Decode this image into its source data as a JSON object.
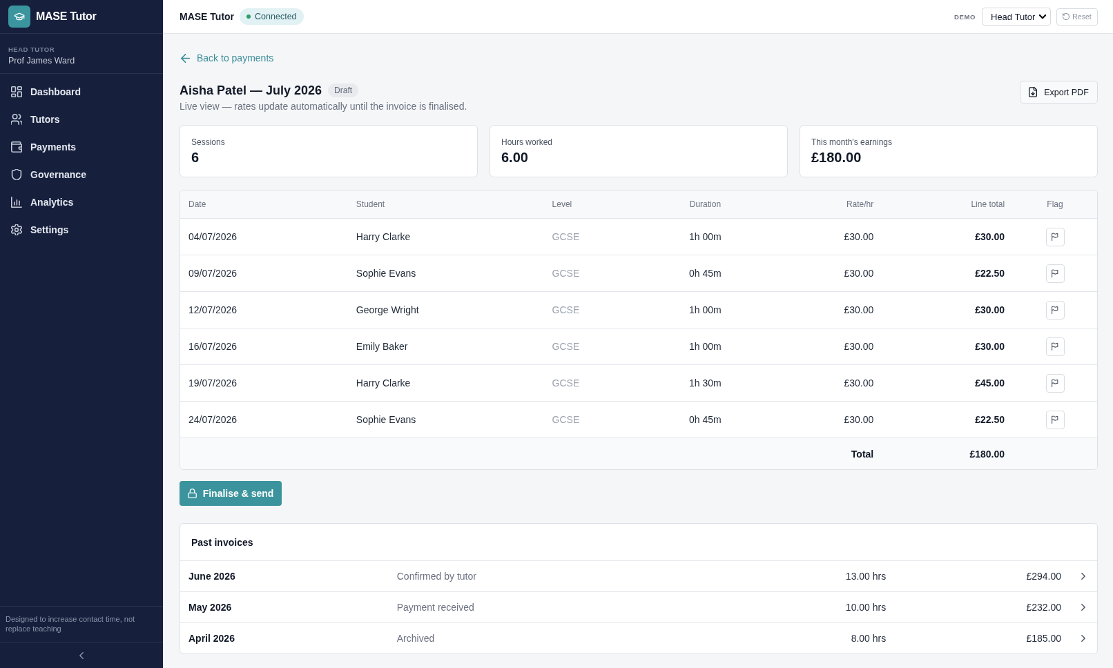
{
  "sidebar": {
    "brand": "MASE Tutor",
    "user": {
      "role": "HEAD TUTOR",
      "name": "Prof James Ward"
    },
    "nav": [
      {
        "label": "Dashboard",
        "selected": false
      },
      {
        "label": "Tutors",
        "selected": false
      },
      {
        "label": "Payments",
        "selected": false
      },
      {
        "label": "Governance",
        "selected": false
      },
      {
        "label": "Analytics",
        "selected": false
      },
      {
        "label": "Settings",
        "selected": false
      }
    ],
    "footer_note": "Designed to increase contact time, not replace teaching"
  },
  "topbar": {
    "title": "MASE Tutor",
    "connection": "Connected",
    "demo_label": "DEMO",
    "role_select": {
      "value": "Head Tutor"
    },
    "reset_button": "Reset"
  },
  "invoice": {
    "back_link": "Back to payments",
    "title": "Aisha Patel — July 2026",
    "status_badge": "Draft",
    "subtitle": "Live view — rates update automatically until the invoice is finalised.",
    "export_button": "Export PDF"
  },
  "stats": [
    {
      "label": "Sessions",
      "value": "6"
    },
    {
      "label": "Hours worked",
      "value": "6.00"
    },
    {
      "label": "This month's earnings",
      "value": "£180.00"
    }
  ],
  "table": {
    "columns": [
      "Date",
      "Student",
      "Level",
      "Duration",
      "Rate/hr",
      "Line total",
      "Flag"
    ],
    "rows": [
      {
        "date": "04/07/2026",
        "student": "Harry Clarke",
        "level": "GCSE",
        "duration": "1h 00m",
        "rate": "£30.00",
        "line_total": "£30.00"
      },
      {
        "date": "09/07/2026",
        "student": "Sophie Evans",
        "level": "GCSE",
        "duration": "0h 45m",
        "rate": "£30.00",
        "line_total": "£22.50"
      },
      {
        "date": "12/07/2026",
        "student": "George Wright",
        "level": "GCSE",
        "duration": "1h 00m",
        "rate": "£30.00",
        "line_total": "£30.00"
      },
      {
        "date": "16/07/2026",
        "student": "Emily Baker",
        "level": "GCSE",
        "duration": "1h 00m",
        "rate": "£30.00",
        "line_total": "£30.00"
      },
      {
        "date": "19/07/2026",
        "student": "Harry Clarke",
        "level": "GCSE",
        "duration": "1h 30m",
        "rate": "£30.00",
        "line_total": "£45.00"
      },
      {
        "date": "24/07/2026",
        "student": "Sophie Evans",
        "level": "GCSE",
        "duration": "0h 45m",
        "rate": "£30.00",
        "line_total": "£22.50"
      }
    ],
    "total": {
      "label": "Total",
      "value": "£180.00"
    }
  },
  "finalise_button": "Finalise & send",
  "past_invoices": {
    "title": "Past invoices",
    "rows": [
      {
        "month": "June 2026",
        "status": "Confirmed by tutor",
        "hours": "13.00 hrs",
        "amount": "£294.00"
      },
      {
        "month": "May 2026",
        "status": "Payment received",
        "hours": "10.00 hrs",
        "amount": "£232.00"
      },
      {
        "month": "April 2026",
        "status": "Archived",
        "hours": "8.00 hrs",
        "amount": "£185.00"
      }
    ]
  }
}
